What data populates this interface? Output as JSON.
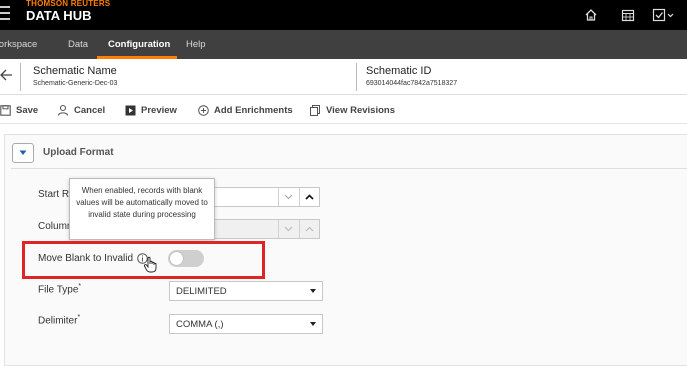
{
  "header": {
    "brand_small": "THOMSON REUTERS",
    "brand_main": "DATA HUB",
    "icons": [
      "home-icon",
      "calendar-icon",
      "task-dropdown-icon"
    ]
  },
  "nav": {
    "items": [
      "Workspace",
      "Data",
      "Configuration",
      "Help"
    ],
    "active": "Configuration"
  },
  "schematic": {
    "name_label": "Schematic Name",
    "name_value": "Schematic-Generic-Dec-03",
    "id_label": "Schematic ID",
    "id_value": "693014044fac7842a7518327"
  },
  "toolbar": {
    "save": "Save",
    "cancel": "Cancel",
    "preview": "Preview",
    "add_enrichments": "Add Enrichments",
    "view_revisions": "View Revisions"
  },
  "section": {
    "title": "Upload Format"
  },
  "fields": {
    "start_row_label": "Start R",
    "column_label": "Column",
    "move_blank_label": "Move Blank to Invalid",
    "move_blank_enabled": false,
    "file_type_label": "File Type",
    "file_type_value": "DELIMITED",
    "delimiter_label": "Delimiter",
    "delimiter_value": "COMMA (,)",
    "required_mark": "*"
  },
  "tooltip": {
    "text": "When enabled, records with blank values will be automatically moved to invalid state during processing"
  },
  "colors": {
    "accent": "#ff8000",
    "highlight": "#e02424",
    "nav_bg": "#404040",
    "header_bg": "#000000"
  }
}
